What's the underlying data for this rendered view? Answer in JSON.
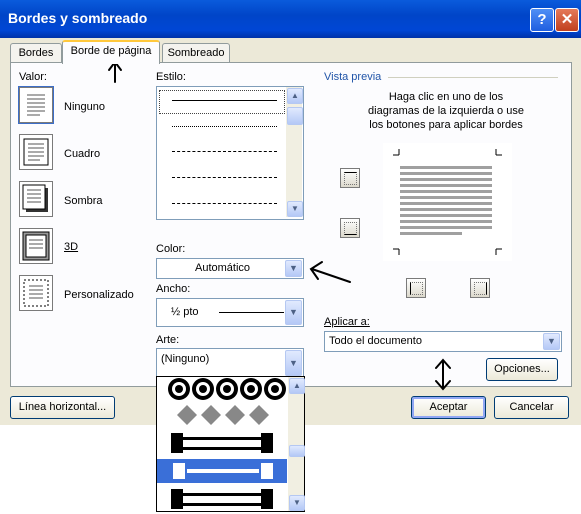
{
  "window": {
    "title": "Bordes y sombreado",
    "help_glyph": "?",
    "close_glyph": "✕"
  },
  "tabs": [
    {
      "label": "Bordes"
    },
    {
      "label": "Borde de página"
    },
    {
      "label": "Sombreado"
    }
  ],
  "valor": {
    "label": "Valor:",
    "items": [
      {
        "label": "Ninguno"
      },
      {
        "label": "Cuadro"
      },
      {
        "label": "Sombra"
      },
      {
        "label": "3D"
      },
      {
        "label": "Personalizado"
      }
    ]
  },
  "estilo": {
    "label": "Estilo:"
  },
  "color": {
    "label": "Color:",
    "value": "Automático"
  },
  "ancho": {
    "label": "Ancho:",
    "value": "½ pto"
  },
  "arte": {
    "label": "Arte:",
    "value": "(Ninguno)"
  },
  "preview": {
    "label": "Vista previa",
    "instructions_1": "Haga clic en uno de los",
    "instructions_2": "diagramas de la izquierda o use",
    "instructions_3": "los botones para aplicar bordes"
  },
  "aplicar": {
    "label": "Aplicar a:",
    "value": "Todo el documento"
  },
  "buttons": {
    "opciones": "Opciones...",
    "linea_horizontal": "Línea horizontal...",
    "aceptar": "Aceptar",
    "cancelar": "Cancelar"
  },
  "colors": {
    "titlebar": "#0046d5",
    "dialog_bg": "#ece9d8",
    "selection": "#3a6fd8"
  }
}
